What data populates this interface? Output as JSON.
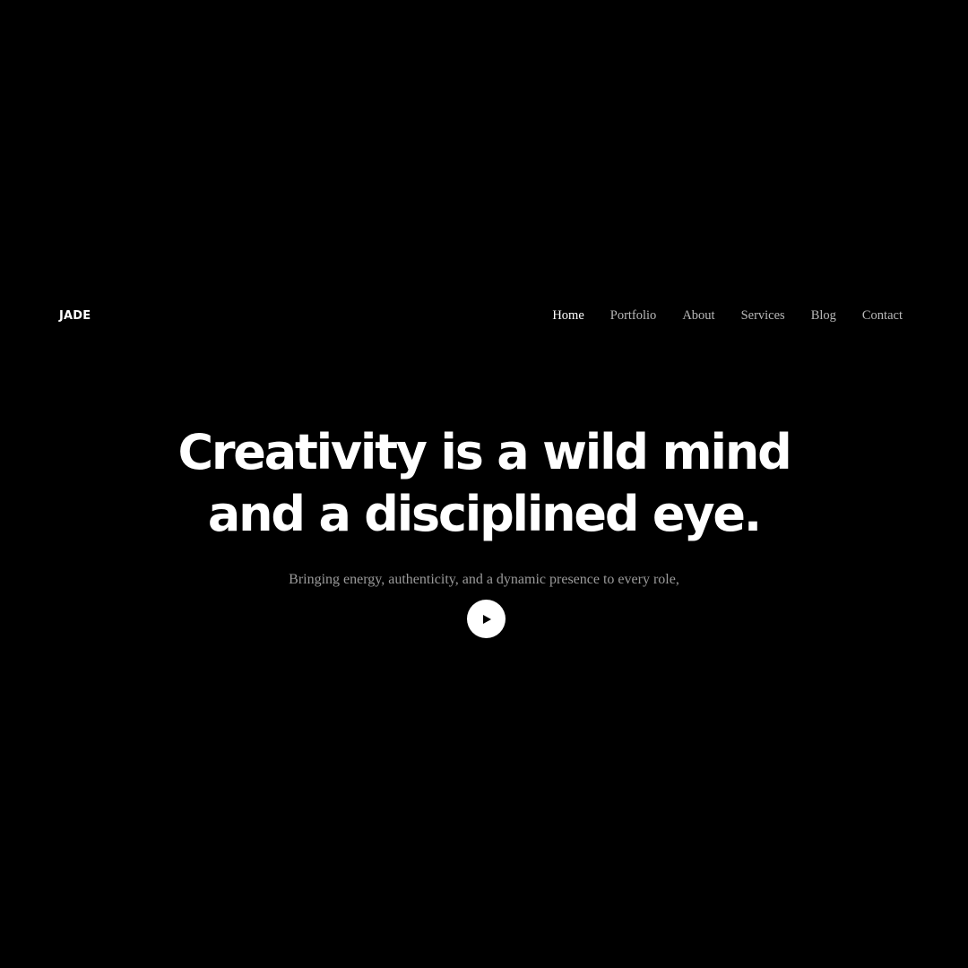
{
  "header": {
    "logo": "JADE",
    "nav": [
      {
        "label": "Home",
        "active": true
      },
      {
        "label": "Portfolio",
        "active": false
      },
      {
        "label": "About",
        "active": false
      },
      {
        "label": "Services",
        "active": false
      },
      {
        "label": "Blog",
        "active": false
      },
      {
        "label": "Contact",
        "active": false
      }
    ]
  },
  "hero": {
    "headline_line1": "Creativity is a wild mind",
    "headline_line2": "and a disciplined eye.",
    "subtitle": "Bringing energy, authenticity, and a dynamic presence to every role,",
    "play_icon": "play-icon"
  },
  "colors": {
    "background": "#000000",
    "text_primary": "#ffffff",
    "text_muted": "#9b9b9b",
    "nav_inactive": "#b9b9b9"
  }
}
